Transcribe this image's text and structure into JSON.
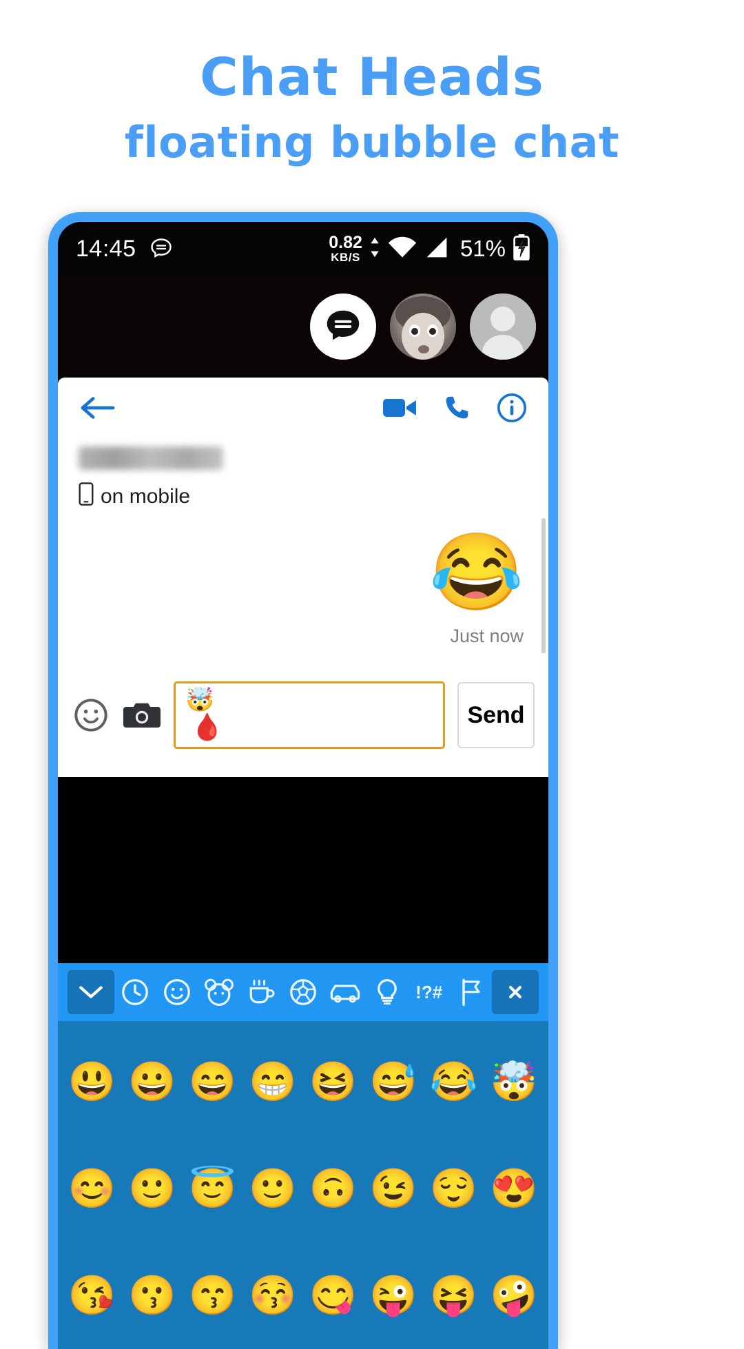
{
  "promo": {
    "title": "Chat Heads",
    "subtitle": "floating bubble chat",
    "accent_color": "#4a9ef5"
  },
  "phone": {
    "frame_color": "#41a0f7"
  },
  "statusbar": {
    "time": "14:45",
    "message_icon": "chat-bubble-icon",
    "data_rate_value": "0.82",
    "data_rate_unit": "KB/S",
    "wifi_icon": "wifi-icon",
    "signal_icon": "signal-bars-icon",
    "battery_percent": "51%",
    "battery_icon": "battery-charging-icon"
  },
  "chat_heads": [
    {
      "name": "chat-head-messages",
      "type": "chat-bubble-icon",
      "label": ""
    },
    {
      "name": "chat-head-baby",
      "type": "photo-avatar",
      "label": ""
    },
    {
      "name": "chat-head-default",
      "type": "default-avatar",
      "label": ""
    }
  ],
  "chat": {
    "back_icon": "back-arrow-icon",
    "video_icon": "video-camera-icon",
    "call_icon": "phone-icon",
    "info_icon": "info-icon",
    "contact_name": "",
    "contact_status": "on mobile",
    "contact_status_icon": "mobile-phone-icon",
    "accent_color": "#1775d1",
    "messages": [
      {
        "kind": "emoji-large",
        "content": "😂",
        "timestamp": "Just now"
      },
      {
        "kind": "bubble",
        "content": "😂",
        "timestamp": "Just now"
      }
    ]
  },
  "input": {
    "emoji_icon": "emoji-face-icon",
    "camera_icon": "camera-icon",
    "field_value_1": "🤯",
    "field_value_2": "🩸",
    "field_placeholder": "",
    "field_border_color": "#e09b1e",
    "send_label": "Send"
  },
  "keyboard": {
    "tabs": [
      {
        "name": "collapse-keyboard-button",
        "glyph": "⌄",
        "selected": true
      },
      {
        "name": "recent-emoji-tab",
        "glyph": "◴"
      },
      {
        "name": "smileys-tab",
        "glyph": "☺"
      },
      {
        "name": "animals-tab",
        "glyph": "🐻"
      },
      {
        "name": "food-tab",
        "glyph": "☕"
      },
      {
        "name": "sports-tab",
        "glyph": "⚽"
      },
      {
        "name": "travel-tab",
        "glyph": "🚗"
      },
      {
        "name": "objects-tab",
        "glyph": "💡"
      },
      {
        "name": "symbols-tab",
        "glyph": "!?#"
      },
      {
        "name": "flags-tab",
        "glyph": "⚑"
      },
      {
        "name": "backspace-button",
        "glyph": "⌧",
        "delete": true
      }
    ],
    "rows": [
      [
        "😃",
        "😀",
        "😄",
        "😁",
        "😆",
        "😅",
        "😂",
        "🤯"
      ],
      [
        "😊",
        "🙂",
        "😇",
        "🙂",
        "🙃",
        "😉",
        "😌",
        "😍"
      ],
      [
        "😘",
        "😗",
        "😙",
        "😚",
        "😋",
        "😜",
        "😝",
        "🤪"
      ]
    ],
    "bg_color": "#1779b8",
    "toolbar_color": "#2196f3"
  }
}
